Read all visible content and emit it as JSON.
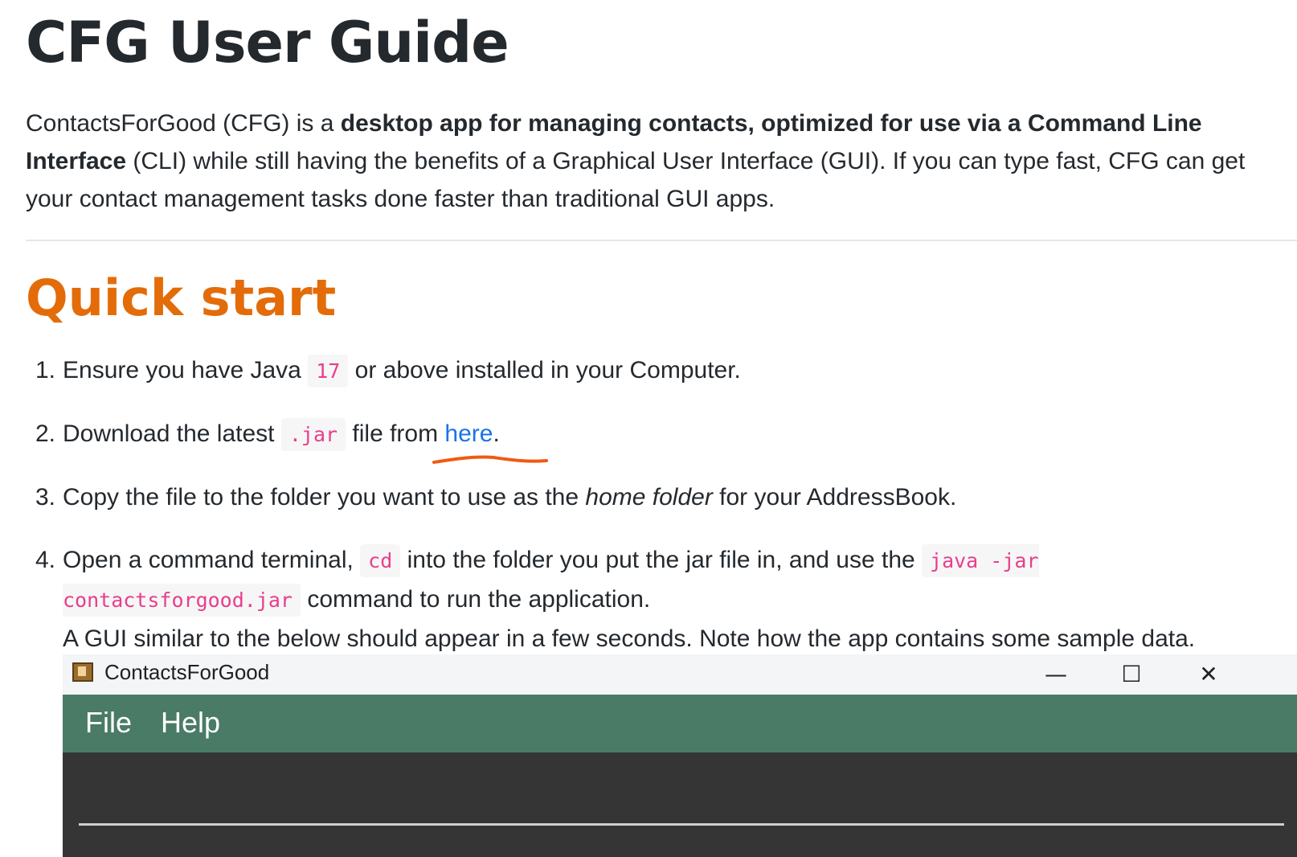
{
  "doc": {
    "title": "CFG User Guide",
    "intro": {
      "p1": "ContactsForGood (CFG) is a ",
      "bold": "desktop app for managing contacts, optimized for use via a Command Line Interface",
      "p2": " (CLI) while still having the benefits of a Graphical User Interface (GUI). If you can type fast, CFG can get your contact management tasks done faster than traditional GUI apps."
    },
    "section_title": "Quick start",
    "steps": [
      {
        "num": "1.",
        "a": "Ensure you have Java ",
        "code": "17",
        "b": " or above installed in your Computer."
      },
      {
        "num": "2.",
        "a": "Download the latest ",
        "code": ".jar",
        "b": " file from ",
        "link": "here",
        "c": "."
      },
      {
        "num": "3.",
        "a": "Copy the file to the folder you want to use as the ",
        "em": "home folder",
        "b": " for your AddressBook."
      },
      {
        "num": "4.",
        "a": "Open a command terminal, ",
        "code1": "cd",
        "b": " into the folder you put the jar file in, and use the ",
        "code2": "java -jar contactsforgood.jar",
        "c": " command to run the application.",
        "d": "A GUI similar to the below should appear in a few seconds. Note how the app contains some sample data."
      }
    ]
  },
  "app_window": {
    "title": "ContactsForGood",
    "minimize": "—",
    "maximize": "☐",
    "close": "✕",
    "menu": [
      "File",
      "Help"
    ],
    "menubar_color": "#4a7b67"
  },
  "annotation": {
    "underline_color": "#f05a12"
  },
  "colors": {
    "heading_accent": "#e36c09",
    "link": "#1a73e8",
    "code": "#e83e8c"
  }
}
